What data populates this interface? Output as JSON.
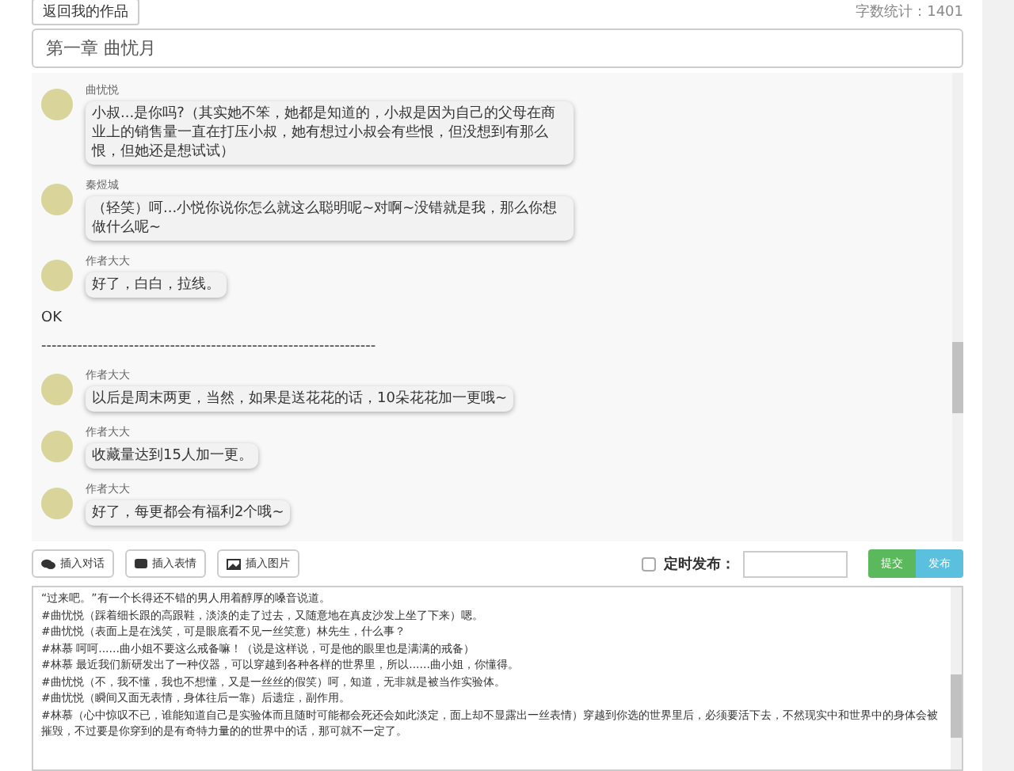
{
  "top_bar": {
    "back_button": "返回我的作品",
    "word_count": "字数统计：1401"
  },
  "chapter_title": "第一章 曲忧月",
  "chat": [
    {
      "kind": "message",
      "name": "曲忧悦",
      "text": "小叔...是你吗?（其实她不笨，她都是知道的，小叔是因为自己的父母在商业上的销售量一直在打压小叔，她有想过小叔会有些恨，但没想到有那么恨，但她还是想试试）"
    },
    {
      "kind": "message",
      "name": "秦煜城",
      "text": "（轻笑）呵...小悦你说你怎么就这么聪明呢~对啊~没错就是我，那么你想做什么呢~"
    },
    {
      "kind": "message",
      "name": "作者大大",
      "text": "好了，白白，拉线。"
    },
    {
      "kind": "text",
      "text": "OK"
    },
    {
      "kind": "text",
      "text": "-----------------------------------------------------------------"
    },
    {
      "kind": "message",
      "name": "作者大大",
      "text": "以后是周末两更，当然，如果是送花花的话，10朵花花加一更哦~"
    },
    {
      "kind": "message",
      "name": "作者大大",
      "text": "收藏量达到15人加一更。"
    },
    {
      "kind": "message",
      "name": "作者大大",
      "text": "好了，每更都会有福利2个哦~"
    }
  ],
  "toolbar": {
    "buttons": [
      "插入对话",
      "插入表情",
      "插入图片"
    ],
    "schedule": {
      "label": "定时发布：",
      "checked": false
    },
    "submit": "提交",
    "publish": "发布"
  },
  "editor": [
    "“过来吧。”有一个长得还不错的男人用着醇厚的嗓音说道。",
    "#曲忧悦（踩着细长跟的高跟鞋，淡淡的走了过去，又随意地在真皮沙发上坐了下来）嗯。",
    "#曲忧悦（表面上是在浅笑，可是眼底看不见一丝笑意）林先生，什么事？",
    "#林慕 呵呵......曲小姐不要这么戒备嘛！（说是这样说，可是他的眼里也是满满的戒备）",
    "#林慕 最近我们新研发出了一种仪器，可以穿越到各种各样的世界里，所以......曲小姐，你懂得。",
    "#曲忧悦（不，我不懂，我也不想懂，又是一丝丝的假笑）呵，知道，无非就是被当作实验体。",
    "#曲忧悦（瞬间又面无表情，身体往后一靠）后遗症，副作用。",
    "#林慕（心中惊叹不已，谁能知道自己是实验体而且随时可能都会死还会如此淡定，面上却不显露出一丝表情）穿越到你选的世界里后，必须要活下去，不然现实中和世界中的身体会被摧毁，不过要是你穿到的是有奇特力量的的世界中的话，那可就不一定了。"
  ]
}
